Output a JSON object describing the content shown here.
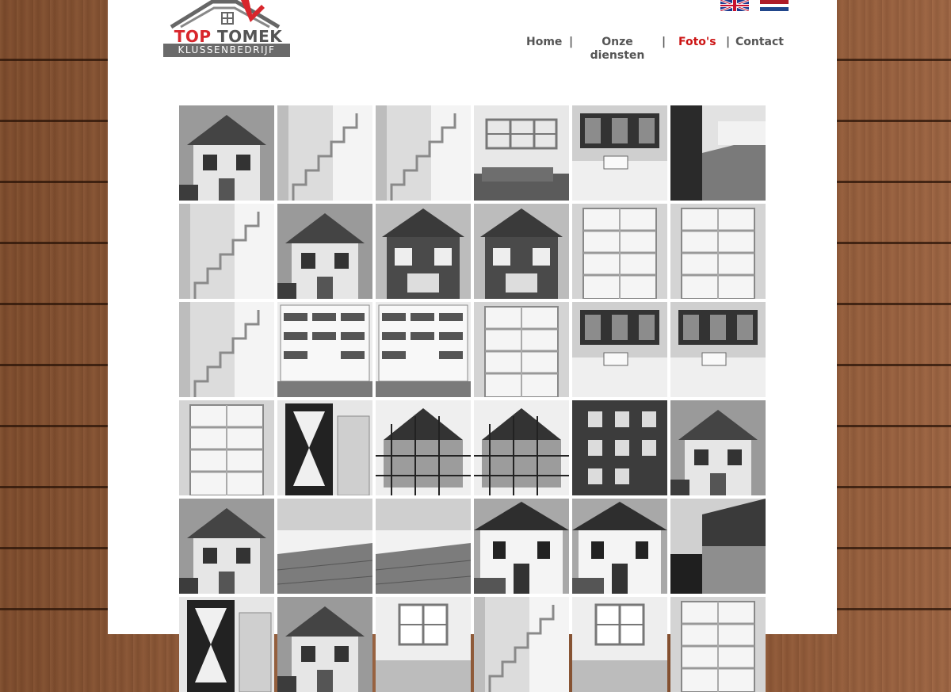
{
  "logo": {
    "word1": "TOP",
    "word2": "TOMEK",
    "subtitle": "KLUSSENBEDRIJF"
  },
  "flags": [
    {
      "name": "flag-en-icon"
    },
    {
      "name": "flag-nl-icon"
    }
  ],
  "nav": {
    "home": "Home",
    "onze": "Onze diensten",
    "fotos": "Foto's",
    "contact": "Contact",
    "separator": "|"
  },
  "colors": {
    "active_nav": "#cc1414",
    "nav_text": "#555555",
    "logo_red": "#d8262c"
  },
  "gallery": [
    {
      "kind": "house"
    },
    {
      "kind": "stairs"
    },
    {
      "kind": "stairs"
    },
    {
      "kind": "shelf"
    },
    {
      "kind": "interior"
    },
    {
      "kind": "boat"
    },
    {
      "kind": "stairs"
    },
    {
      "kind": "house"
    },
    {
      "kind": "brickhouse"
    },
    {
      "kind": "brickhouse"
    },
    {
      "kind": "cabinet"
    },
    {
      "kind": "cabinet"
    },
    {
      "kind": "stairs"
    },
    {
      "kind": "bookcase"
    },
    {
      "kind": "bookcase"
    },
    {
      "kind": "cabinet"
    },
    {
      "kind": "interior"
    },
    {
      "kind": "interior"
    },
    {
      "kind": "cabinet"
    },
    {
      "kind": "door"
    },
    {
      "kind": "scaffold"
    },
    {
      "kind": "scaffold"
    },
    {
      "kind": "building"
    },
    {
      "kind": "house"
    },
    {
      "kind": "house"
    },
    {
      "kind": "floor"
    },
    {
      "kind": "floor"
    },
    {
      "kind": "whitehouse"
    },
    {
      "kind": "whitehouse"
    },
    {
      "kind": "wall"
    },
    {
      "kind": "door"
    },
    {
      "kind": "house"
    },
    {
      "kind": "window"
    },
    {
      "kind": "stairs"
    },
    {
      "kind": "window"
    },
    {
      "kind": "cabinet"
    }
  ]
}
